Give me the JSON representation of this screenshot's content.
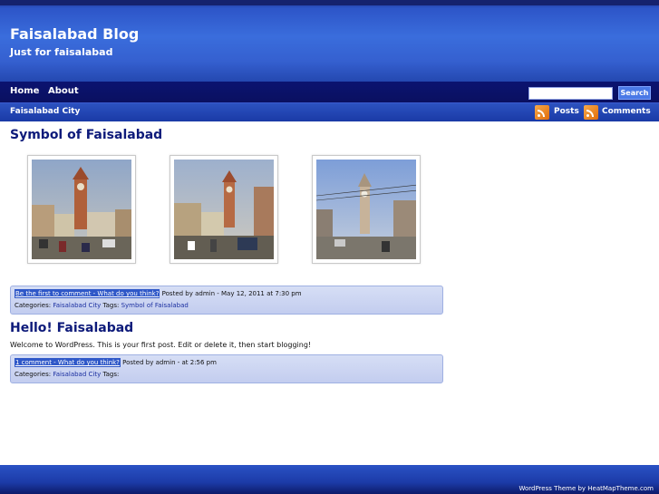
{
  "header": {
    "title": "Faisalabad Blog",
    "tagline": "Just for faisalabad"
  },
  "nav": {
    "items": [
      {
        "label": "Home"
      },
      {
        "label": "About"
      }
    ]
  },
  "search": {
    "button": "Search",
    "value": ""
  },
  "subbar": {
    "category": "Faisalabad City",
    "posts_feed": "Posts",
    "comments_feed": "Comments"
  },
  "posts": [
    {
      "title": "Symbol of Faisalabad",
      "comment_link": "Be the first to comment - What do you think?",
      "posted": "Posted by admin - May 12, 2011 at 7:30 pm",
      "categories_label": "Categories:",
      "category": "Faisalabad City",
      "tags_label": "Tags:",
      "tag": "Symbol of Faisalabad"
    },
    {
      "title": "Hello! Faisalabad",
      "body": "Welcome to WordPress. This is your first post. Edit or delete it, then start blogging!",
      "comment_link": "1 comment - What do you think?",
      "posted": "Posted by admin - at 2:56 pm",
      "categories_label": "Categories:",
      "category": "Faisalabad City",
      "tags_label": "Tags:"
    }
  ],
  "footer": {
    "credit": "WordPress Theme by HeatMapTheme.com"
  },
  "colors": {
    "header": "#3a6ddc",
    "nav": "#0b1370",
    "title_text": "#0d1a7a",
    "meta_bg": "#c3cdef"
  }
}
